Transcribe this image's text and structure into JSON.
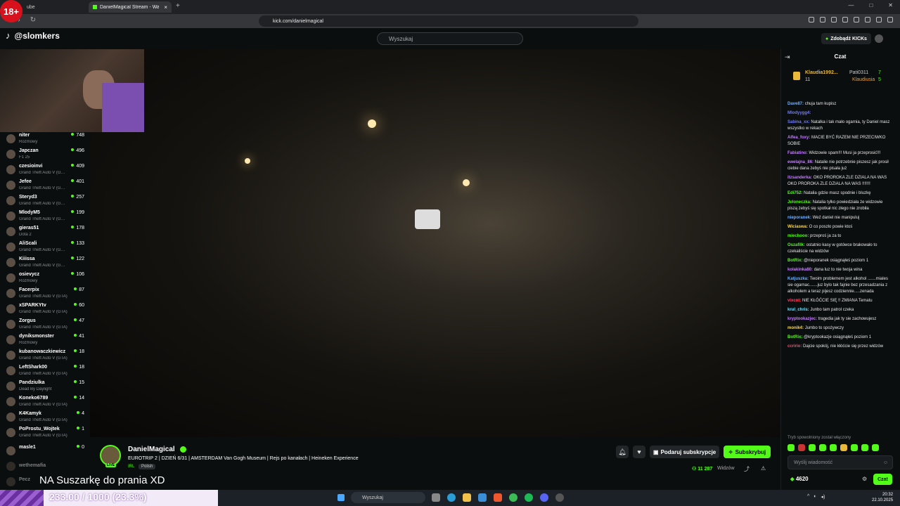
{
  "overlay": {
    "age_badge": "18+",
    "caption": "NA Suszarkę do prania XD",
    "goal_text": "233.00 / 1000 (23.3%)",
    "goal_progress": 0.233,
    "handle": "@slomkers"
  },
  "browser": {
    "tabs": [
      {
        "label": "ube"
      },
      {
        "label": "DanielMagical Stream - Watc"
      }
    ],
    "url": "kick.com/danielmagical"
  },
  "header": {
    "search_placeholder": "Wyszukaj",
    "kicks_label": "Zdobądź KICKs"
  },
  "sidebar": {
    "channels": [
      {
        "name": "niter",
        "game": "Rozmowy",
        "viewers": "748"
      },
      {
        "name": "Japczan",
        "game": "F1 25",
        "viewers": "496"
      },
      {
        "name": "czesioinvi",
        "game": "Grand Theft Auto V (G…",
        "viewers": "409"
      },
      {
        "name": "Jefee",
        "game": "Grand Theft Auto V (G…",
        "viewers": "401"
      },
      {
        "name": "Steryd3",
        "game": "Grand Theft Auto V (G…",
        "viewers": "257"
      },
      {
        "name": "MlodyM5",
        "game": "Grand Theft Auto V (G…",
        "viewers": "199"
      },
      {
        "name": "gieras51",
        "game": "Dota 2",
        "viewers": "178"
      },
      {
        "name": "AliScali",
        "game": "Grand Theft Auto V (G…",
        "viewers": "133"
      },
      {
        "name": "Kiiissa",
        "game": "Grand Theft Auto V (G…",
        "viewers": "122"
      },
      {
        "name": "osievycz",
        "game": "Rozmowy",
        "viewers": "106"
      },
      {
        "name": "Facerpix",
        "game": "Grand Theft Auto V (GTA)",
        "viewers": "87"
      },
      {
        "name": "xSPARKYtv",
        "game": "Grand Theft Auto V (GTA)",
        "viewers": "60"
      },
      {
        "name": "Zorgus",
        "game": "Grand Theft Auto V (GTA)",
        "viewers": "47"
      },
      {
        "name": "dyniksmonster",
        "game": "Rozmowy",
        "viewers": "41"
      },
      {
        "name": "kubanowaczkiewicz",
        "game": "Grand Theft Auto V (GTA)",
        "viewers": "18"
      },
      {
        "name": "LeftShark00",
        "game": "Grand Theft Auto V (GTA)",
        "viewers": "18"
      },
      {
        "name": "Pandziulka",
        "game": "Dead By Daylight",
        "viewers": "15"
      },
      {
        "name": "Koneko6789",
        "game": "Grand Theft Auto V (GTA)",
        "viewers": "14"
      },
      {
        "name": "K4Kamyk",
        "game": "Grand Theft Auto V (GTA)",
        "viewers": "4"
      },
      {
        "name": "PoProstu_Wojtek",
        "game": "Grand Theft Auto V (GTA)",
        "viewers": "1"
      },
      {
        "name": "masle1",
        "game": "",
        "viewers": "0"
      },
      {
        "name": "wethemafia",
        "game": "",
        "viewers": ""
      },
      {
        "name": "Pecz",
        "game": "",
        "viewers": ""
      }
    ]
  },
  "stream": {
    "name": "DanielMagical",
    "title": "EUROTRIP 2 | DZIEŃ 6/31 | AMSTERDAM Van Gogh Museum | Rejs po kanałach | Heineken Experience",
    "category": "IRL",
    "language": "Polish",
    "live_badge": "LIVE",
    "gift_label": "Podaruj subskrypcje",
    "sub_label": "Subskrybuj",
    "viewers": "11 287",
    "viewers_label": "Widzów"
  },
  "chat": {
    "title": "Czat",
    "pinned": {
      "user1": "Klaudia1992...",
      "user1_count": "11",
      "user2": "Pati0311",
      "user2_count": "7",
      "user3": "Klaudiusia",
      "user3_count": "5"
    },
    "messages": [
      {
        "user": "Dave87:",
        "color": "#6fb0ff",
        "text": "chuja tam kupisz"
      },
      {
        "user": "Mlodyygg4:",
        "color": "#6f7bff",
        "text": ""
      },
      {
        "user": "Sabina_xx:",
        "color": "#6f7bff",
        "text": "Natalka i tak mało ogarnia, ty Daniel masz wszystko w rekach"
      },
      {
        "user": "Alfea_foxy:",
        "color": "#c67bff",
        "text": "MACIE BYĆ RAZEM NIE PRZECIWKO SOBIE"
      },
      {
        "user": "Fabiatino:",
        "color": "#c67bff",
        "text": "Widzowie spam!!! Musi ja przeprosić!!!"
      },
      {
        "user": "ewelajna_86:",
        "color": "#c67bff",
        "text": "Natalie nie potrzebnie piszesz jak prosił ciebie dana żebyś nie pisała już"
      },
      {
        "user": "itzsanderka:",
        "color": "#c67bff",
        "text": "OKO PROROKA ZLE DZIALA NA WAS OKO PROROKA ZLE DZIALA NA WAS !!!!!!!"
      },
      {
        "user": "Edi752:",
        "color": "#53fc18",
        "text": "Natalia gdzie masz spodnie i bluzkę"
      },
      {
        "user": "Jeloneczka:",
        "color": "#53fc18",
        "text": "Natalia tylko powiedziała że widzowie piszą żebyś się spotkał nic złego nie zrobiła"
      },
      {
        "user": "nieporanek:",
        "color": "#6fb0ff",
        "text": "Weź daniel nie manipuluj"
      },
      {
        "user": "Wiciaswa:",
        "color": "#ffd84a",
        "text": "O co poszło powie ktoś"
      },
      {
        "user": "miechooo:",
        "color": "#53fc18",
        "text": "przeproś ja za to"
      },
      {
        "user": "Oszafilk:",
        "color": "#53fc18",
        "text": "ostatnio kasy w gotówce brakowało to czekaliście na widzów"
      },
      {
        "user": "BotRix:",
        "color": "#53fc18",
        "text": "@nieporanek osiągnąłeś poziom 1"
      },
      {
        "user": "kolakinka80:",
        "color": "#c67bff",
        "text": "dana luz to nie twoja wina"
      },
      {
        "user": "Katjuszka:",
        "color": "#6fb0ff",
        "text": "Twoim problemem jest alkohol .......miales sie ogarnac.......juz bylo tak fajnie bez przesadzania z alkoholem a teraz pijesz codziennie.....zenada"
      },
      {
        "user": "vixcnt:",
        "color": "#ff4a6b",
        "text": "NIE KŁÓĆCIE SIĘ !! ZMIANA Tematu"
      },
      {
        "user": "krul_chris:",
        "color": "#6fe0ff",
        "text": "Junbo tam patrol czeka"
      },
      {
        "user": "kryptookazjec:",
        "color": "#c67bff",
        "text": "tragedia jak ty sie zachowujesz"
      },
      {
        "user": "monik4:",
        "color": "#ffd84a",
        "text": "Jumbo to spożywczy"
      },
      {
        "user": "BotRix:",
        "color": "#53fc18",
        "text": "@kryptookazje osiągnąłeś poziom 1"
      },
      {
        "user": "ccririo:",
        "color": "#ff4a6b",
        "text": "Dajcie spokój, nie kłóćcie się przez widzów"
      }
    ],
    "slow_mode": "Tryb spowolniony został włączony",
    "input_placeholder": "Wyślij wiadomość",
    "points": "4620",
    "send_label": "Czat"
  },
  "taskbar": {
    "search": "Wyszukaj",
    "time": "20:32",
    "date": "22.10.2025"
  }
}
